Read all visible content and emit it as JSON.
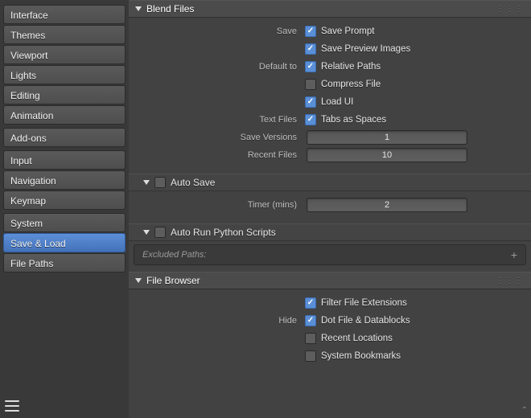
{
  "sidebar": {
    "groups": [
      [
        "Interface",
        "Themes",
        "Viewport",
        "Lights",
        "Editing",
        "Animation"
      ],
      [
        "Add-ons"
      ],
      [
        "Input",
        "Navigation",
        "Keymap"
      ],
      [
        "System",
        "Save & Load",
        "File Paths"
      ]
    ],
    "active": "Save & Load"
  },
  "panels": {
    "blend_files": {
      "title": "Blend Files",
      "rows": [
        {
          "label": "Save",
          "type": "check",
          "checked": true,
          "text": "Save Prompt"
        },
        {
          "label": "",
          "type": "check",
          "checked": true,
          "text": "Save Preview Images"
        },
        {
          "label": "Default to",
          "type": "check",
          "checked": true,
          "text": "Relative Paths"
        },
        {
          "label": "",
          "type": "check",
          "checked": false,
          "text": "Compress File"
        },
        {
          "label": "",
          "type": "check",
          "checked": true,
          "text": "Load UI"
        },
        {
          "label": "Text Files",
          "type": "check",
          "checked": true,
          "text": "Tabs as Spaces"
        },
        {
          "label": "Save Versions",
          "type": "number",
          "value": "1"
        },
        {
          "label": "Recent Files",
          "type": "number",
          "value": "10"
        }
      ],
      "auto_save": {
        "title": "Auto Save",
        "checked": false,
        "timer_label": "Timer (mins)",
        "timer_value": "2"
      },
      "auto_run": {
        "title": "Auto Run Python Scripts",
        "checked": false,
        "excluded_label": "Excluded Paths:"
      }
    },
    "file_browser": {
      "title": "File Browser",
      "rows": [
        {
          "label": "",
          "type": "check",
          "checked": true,
          "text": "Filter File Extensions"
        },
        {
          "label": "Hide",
          "type": "check",
          "checked": true,
          "text": "Dot File & Datablocks"
        },
        {
          "label": "",
          "type": "check",
          "checked": false,
          "text": "Recent Locations"
        },
        {
          "label": "",
          "type": "check",
          "checked": false,
          "text": "System Bookmarks"
        }
      ]
    }
  }
}
